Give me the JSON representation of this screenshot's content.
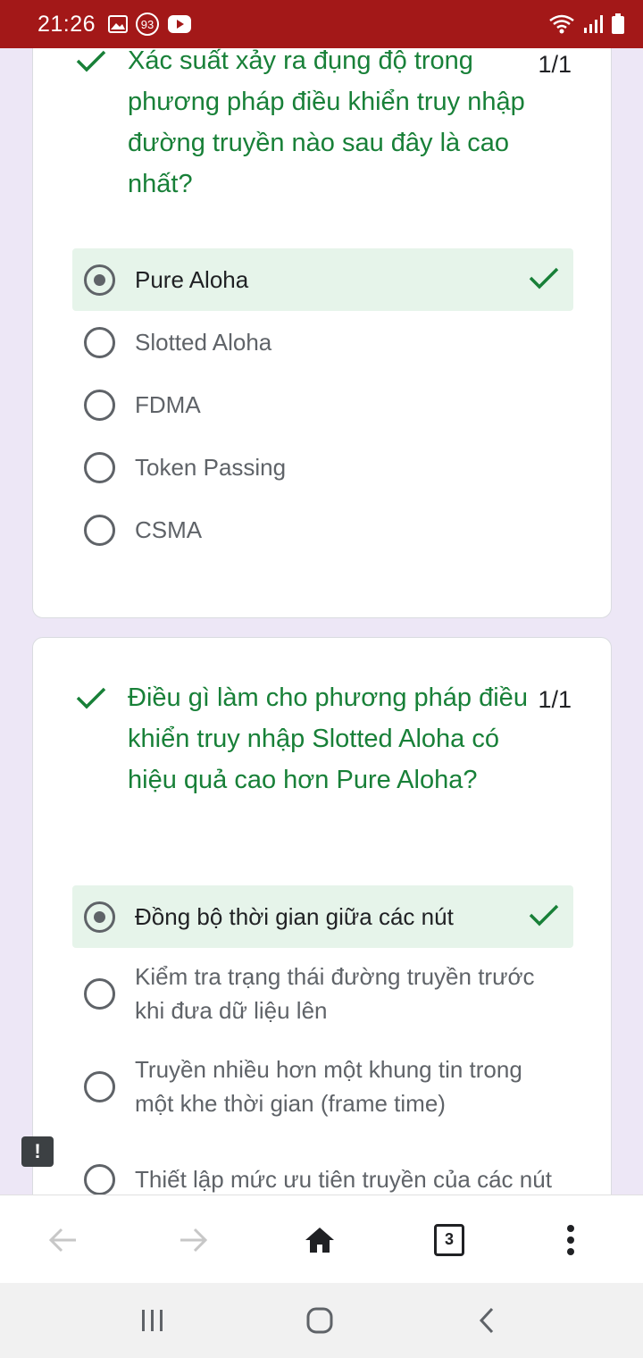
{
  "status_bar": {
    "time": "21:26",
    "notification_count": "93",
    "left_icons": [
      "gallery-icon",
      "notification-count-icon",
      "youtube-icon"
    ],
    "right_icons": [
      "wifi-icon",
      "signal-icon",
      "battery-icon"
    ],
    "background": "#a31818"
  },
  "questions": [
    {
      "text": "Xác suất xảy ra đụng độ trong phương pháp điều khiển truy nhập đường truyền nào sau đây là cao nhất?",
      "score": "1/1",
      "options": [
        {
          "label": "Pure Aloha",
          "selected": true,
          "correct": true
        },
        {
          "label": "Slotted Aloha",
          "selected": false
        },
        {
          "label": "FDMA",
          "selected": false
        },
        {
          "label": "Token Passing",
          "selected": false
        },
        {
          "label": "CSMA",
          "selected": false
        }
      ]
    },
    {
      "text": "Điều gì làm cho phương pháp điều khiển truy nhập Slotted Aloha có hiệu quả cao hơn Pure Aloha?",
      "score": "1/1",
      "options": [
        {
          "label": "Đồng bộ thời gian giữa các nút",
          "selected": true,
          "correct": true
        },
        {
          "label": "Kiểm tra trạng thái đường truyền trước khi đưa dữ liệu lên",
          "selected": false
        },
        {
          "label": "Truyền nhiều hơn một khung tin trong một khe thời gian (frame time)",
          "selected": false
        },
        {
          "label": "Thiết lập mức ưu tiên truyền của các nút",
          "selected": false
        }
      ]
    }
  ],
  "feedback_button": {
    "label": "!"
  },
  "browser_toolbar": {
    "tab_count": "3"
  },
  "colors": {
    "correct_green": "#188038",
    "correct_bg": "#e6f4ea",
    "page_bg": "#ede7f6"
  }
}
